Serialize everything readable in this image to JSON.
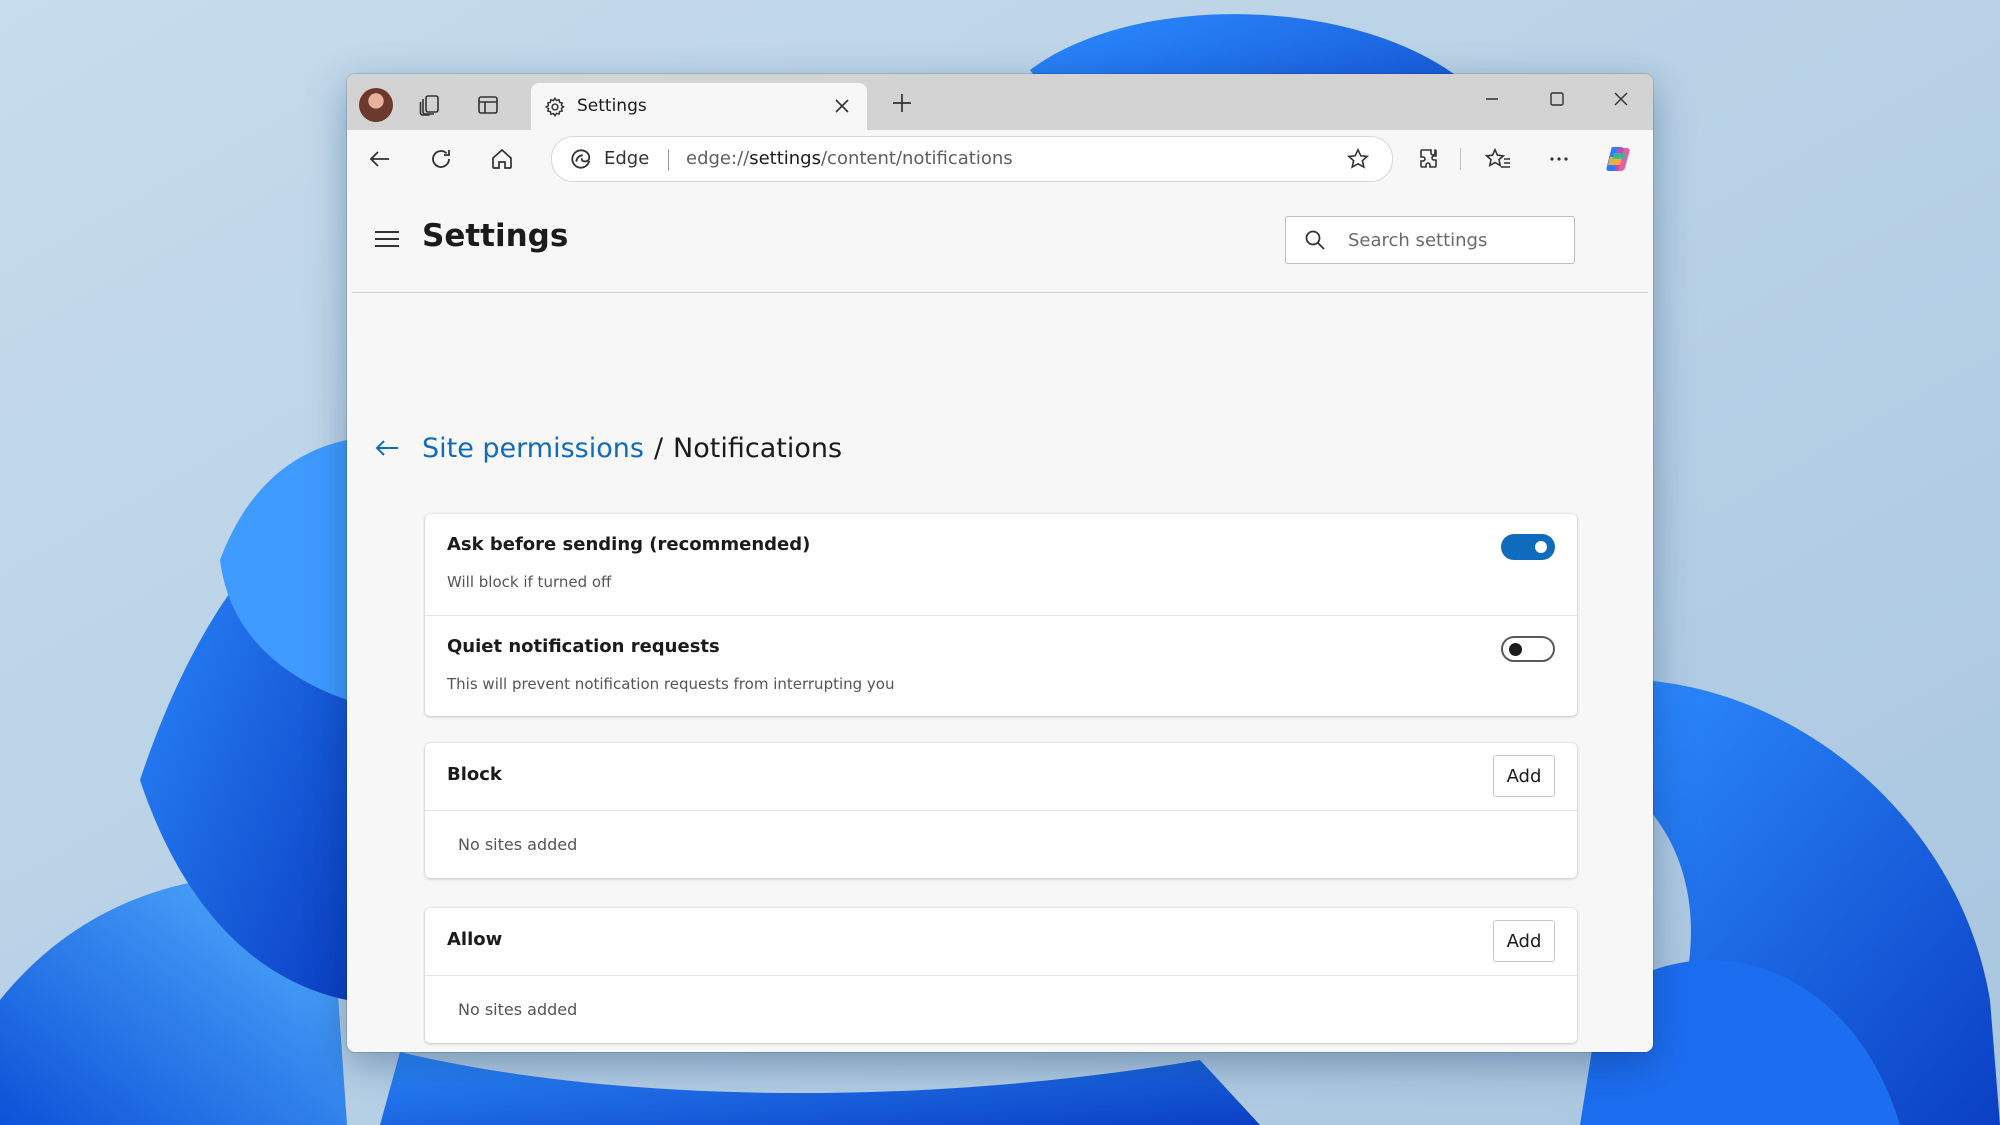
{
  "tab": {
    "title": "Settings"
  },
  "addressbar": {
    "site_label": "Edge",
    "url_prefix": "edge://",
    "url_strong": "settings",
    "url_suffix": "/content/notifications"
  },
  "settings": {
    "title": "Settings",
    "search_placeholder": "Search settings"
  },
  "breadcrumb": {
    "parent": "Site permissions",
    "separator": "/",
    "current": "Notifications"
  },
  "toggles": [
    {
      "title": "Ask before sending (recommended)",
      "description": "Will block if turned off",
      "state": "on"
    },
    {
      "title": "Quiet notification requests",
      "description": "This will prevent notification requests from interrupting you",
      "state": "off"
    }
  ],
  "lists": [
    {
      "title": "Block",
      "add_label": "Add",
      "empty_text": "No sites added"
    },
    {
      "title": "Allow",
      "add_label": "Add",
      "empty_text": "No sites added"
    }
  ],
  "colors": {
    "accent": "#0f6cbd",
    "link": "#0f6cbd",
    "desktop": "#b9d2e6"
  }
}
